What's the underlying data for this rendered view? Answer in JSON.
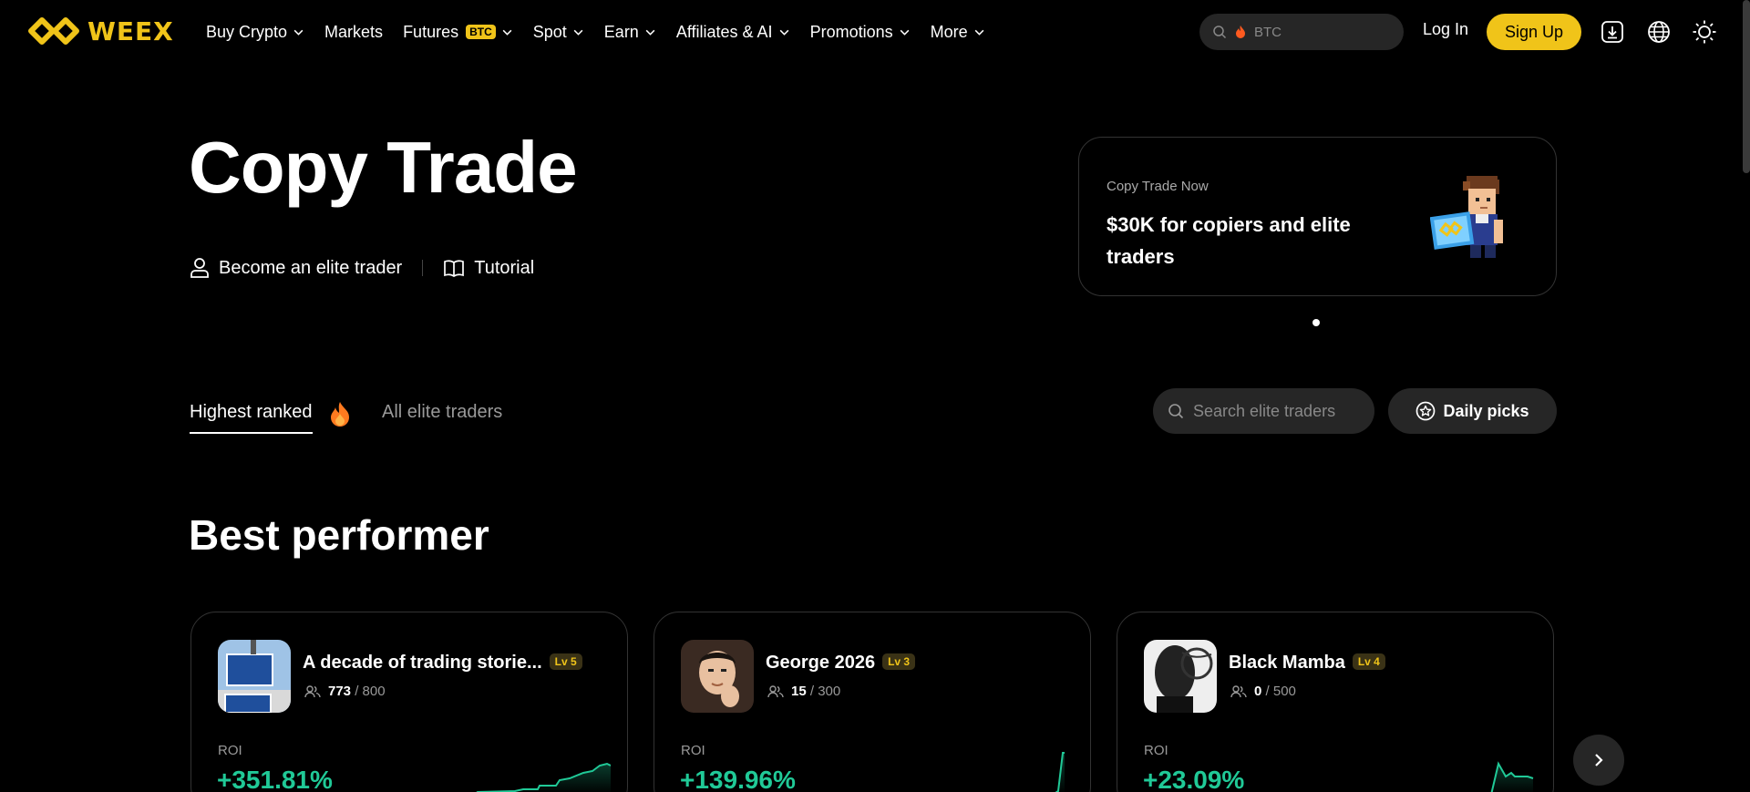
{
  "brand": {
    "name": "WEEX",
    "color": "#f0c419"
  },
  "nav": {
    "items": [
      {
        "label": "Buy Crypto",
        "dropdown": true
      },
      {
        "label": "Markets",
        "dropdown": false
      },
      {
        "label": "Futures",
        "badge": "BTC",
        "dropdown": true
      },
      {
        "label": "Spot",
        "dropdown": true
      },
      {
        "label": "Earn",
        "dropdown": true
      },
      {
        "label": "Affiliates & AI",
        "dropdown": true
      },
      {
        "label": "Promotions",
        "dropdown": true
      },
      {
        "label": "More",
        "dropdown": true
      }
    ],
    "search_placeholder": "BTC",
    "login": "Log In",
    "signup": "Sign Up",
    "icons": [
      "download-icon",
      "globe-icon",
      "sun-icon"
    ]
  },
  "hero": {
    "title": "Copy Trade",
    "links": [
      "Become an elite trader",
      "Tutorial"
    ]
  },
  "promo": {
    "small": "Copy Trade Now",
    "big": "$30K for copiers and elite traders"
  },
  "tabs": {
    "active": "Highest ranked",
    "inactive": "All elite traders",
    "search_placeholder": "Search elite traders",
    "daily_picks": "Daily picks"
  },
  "section_title": "Best performer",
  "cards": [
    {
      "name": "A decade of trading storie...",
      "level": "Lv 5",
      "followers": "773",
      "capacity": "/ 800",
      "roi_label": "ROI",
      "roi": "+351.81%"
    },
    {
      "name": "George 2026",
      "level": "Lv 3",
      "followers": "15",
      "capacity": "/ 300",
      "roi_label": "ROI",
      "roi": "+139.96%"
    },
    {
      "name": "Black Mamba",
      "level": "Lv 4",
      "followers": "0",
      "capacity": "/ 500",
      "roi_label": "ROI",
      "roi": "+23.09%"
    }
  ],
  "colors": {
    "accent": "#f0c419",
    "positive": "#20c997",
    "surface": "#262626"
  }
}
